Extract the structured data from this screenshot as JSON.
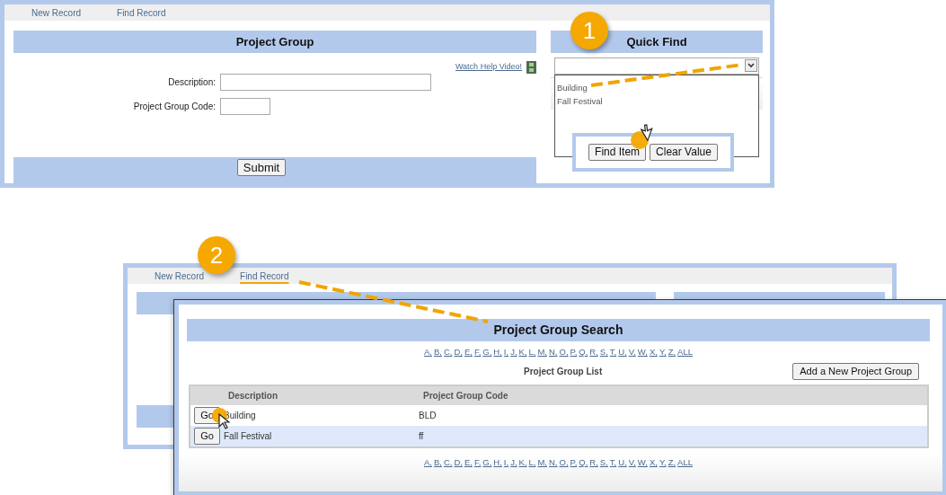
{
  "form_panel": {
    "toolbar": [
      "New Record",
      "Find Record"
    ],
    "callout": "1",
    "title": "Project Group",
    "help_link": "Watch Help Video!",
    "fields": [
      {
        "label": "Description:",
        "kind": "wide"
      },
      {
        "label": "Project Group Code:",
        "kind": "short"
      }
    ],
    "submit": "Submit",
    "quick_find": {
      "title": "Quick Find",
      "expanded": true,
      "options": [
        "Building",
        "Fall Festival"
      ],
      "buttons": [
        "Find Item",
        "Clear Value"
      ]
    }
  },
  "search_panel": {
    "toolbar": [
      {
        "label": "New Record",
        "highlighted": false
      },
      {
        "label": "Find Record",
        "highlighted": true
      }
    ],
    "callout": "2",
    "title": "Project Group Search",
    "letters_top": [
      "A,",
      "B,",
      "C,",
      "D,",
      "E,",
      "F,",
      "G,",
      "H,",
      "I,",
      "J,",
      "K,",
      "L,",
      "M,",
      "N,",
      "O,",
      "P,",
      "Q,",
      "R,",
      "S,",
      "T,",
      "U,",
      "V,",
      "W,",
      "X,",
      "Y,",
      "Z,",
      "ALL"
    ],
    "list_title": "Project Group List",
    "add_button": "Add a New Project Group",
    "columns": [
      "Description",
      "Project Group Code"
    ],
    "rows": [
      {
        "button": "Go",
        "description": "Building",
        "code": "BLD"
      },
      {
        "button": "Go",
        "description": "Fall Festival",
        "code": "ff"
      }
    ],
    "letters_bottom": [
      "A,",
      "B,",
      "C,",
      "D,",
      "E,",
      "F,",
      "G,",
      "H,",
      "I,",
      "J,",
      "K,",
      "L,",
      "M,",
      "N,",
      "O,",
      "P,",
      "Q,",
      "R,",
      "S,",
      "T,",
      "U,",
      "V,",
      "W,",
      "X,",
      "Y,",
      "Z,",
      "ALL"
    ]
  }
}
